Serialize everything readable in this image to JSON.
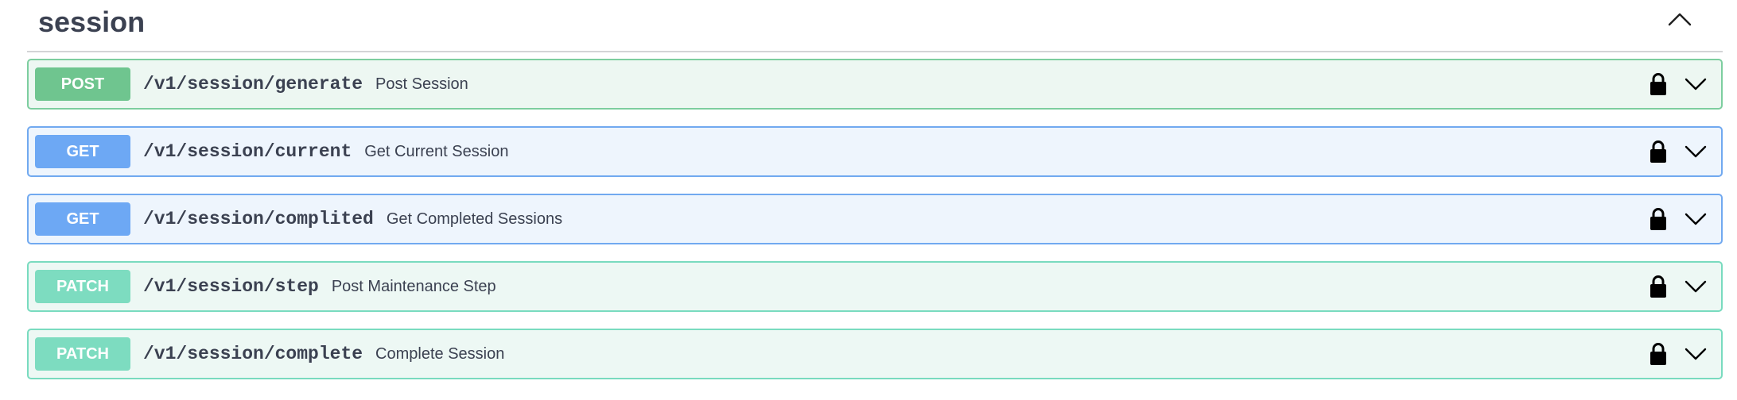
{
  "section": {
    "title": "session",
    "toggle_icon": "chevron-up-icon"
  },
  "operations": [
    {
      "method": "POST",
      "path": "/v1/session/generate",
      "summary": "Post Session",
      "color": "#6fc58f"
    },
    {
      "method": "GET",
      "path": "/v1/session/current",
      "summary": "Get Current Session",
      "color": "#6da8f4"
    },
    {
      "method": "GET",
      "path": "/v1/session/complited",
      "summary": "Get Completed Sessions",
      "color": "#6da8f4"
    },
    {
      "method": "PATCH",
      "path": "/v1/session/step",
      "summary": "Post Maintenance Step",
      "color": "#7ddcc0"
    },
    {
      "method": "PATCH",
      "path": "/v1/session/complete",
      "summary": "Complete Session",
      "color": "#7ddcc0"
    }
  ],
  "icons": {
    "authorize": "lock-icon",
    "expand": "chevron-down-icon"
  }
}
